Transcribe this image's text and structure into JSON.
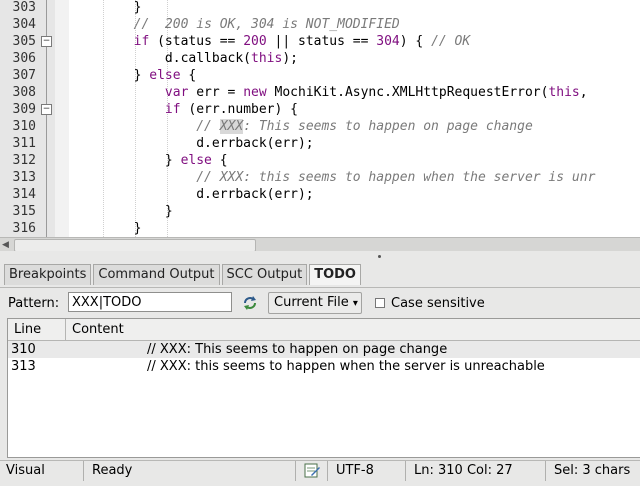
{
  "editor": {
    "lines": [
      {
        "num": "303",
        "fold": "",
        "html": "<span>        }</span>"
      },
      {
        "num": "304",
        "fold": "",
        "html": "        <span class=\"cm\">//  200 is OK, 304 is NOT_MODIFIED</span>"
      },
      {
        "num": "305",
        "fold": "−",
        "html": "        <span class=\"kw\">if</span> (status == <span class=\"num\">200</span> || status == <span class=\"num\">304</span>) { <span class=\"cm\">// OK</span>"
      },
      {
        "num": "306",
        "fold": "",
        "html": "            d.callback(<span class=\"kw\">this</span>);"
      },
      {
        "num": "307",
        "fold": "",
        "html": "        } <span class=\"kw\">else</span> {"
      },
      {
        "num": "308",
        "fold": "",
        "html": "            <span class=\"kw\">var</span> err = <span class=\"kw\">new</span> MochiKit.Async.XMLHttpRequestError(<span class=\"kw\">this</span>, "
      },
      {
        "num": "309",
        "fold": "−",
        "html": "            <span class=\"kw\">if</span> (err.number) {"
      },
      {
        "num": "310",
        "fold": "",
        "html": "                <span class=\"cm\">// <span class=\"hl\">XXX</span>: This seems to happen on page change</span>"
      },
      {
        "num": "311",
        "fold": "",
        "html": "                d.errback(err);"
      },
      {
        "num": "312",
        "fold": "",
        "html": "            } <span class=\"kw\">else</span> {"
      },
      {
        "num": "313",
        "fold": "",
        "html": "                <span class=\"cm\">// XXX: this seems to happen when the server is unr</span>"
      },
      {
        "num": "314",
        "fold": "",
        "html": "                d.errback(err);"
      },
      {
        "num": "315",
        "fold": "",
        "html": "            }"
      },
      {
        "num": "316",
        "fold": "",
        "html": "        }"
      }
    ]
  },
  "tabs": [
    {
      "label": "Breakpoints",
      "active": false
    },
    {
      "label": "Command Output",
      "active": false
    },
    {
      "label": "SCC Output",
      "active": false
    },
    {
      "label": "TODO",
      "active": true
    }
  ],
  "pattern": {
    "label": "Pattern:",
    "value": "XXX|TODO",
    "scope": "Current File",
    "scope_arrow": "▾",
    "case_label": "Case sensitive",
    "case_checked": false
  },
  "results": {
    "columns": [
      "Line",
      "Content"
    ],
    "rows": [
      {
        "line": "310",
        "content": "// XXX: This seems to happen on page change",
        "selected": true
      },
      {
        "line": "313",
        "content": "// XXX: this seems to happen when the server is unreachable",
        "selected": false
      }
    ]
  },
  "status": {
    "mode": "Visual",
    "state": "Ready",
    "encoding": "UTF-8",
    "position": "Ln: 310 Col: 27",
    "selection": "Sel: 3 chars"
  }
}
